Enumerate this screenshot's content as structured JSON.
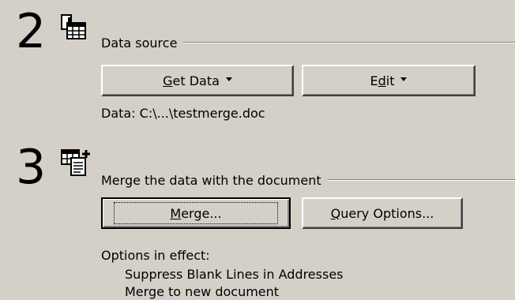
{
  "step2": {
    "number": "2",
    "icon": "data-source-table-icon",
    "title": "Data source",
    "get_data_button": {
      "pre": "",
      "mnemonic": "G",
      "post": "et Data",
      "icon": "dropdown-arrow-icon"
    },
    "edit_button": {
      "pre": "E",
      "mnemonic": "d",
      "post": "it",
      "icon": "dropdown-arrow-icon"
    },
    "data_label": "Data: C:\\...\\testmerge.doc"
  },
  "step3": {
    "number": "3",
    "icon": "merge-table-document-icon",
    "title": "Merge the data with the document",
    "merge_button": {
      "pre": "",
      "mnemonic": "M",
      "post": "erge..."
    },
    "query_button": {
      "pre": "",
      "mnemonic": "Q",
      "post": "uery Options..."
    },
    "options_header": "Options in effect:",
    "options": [
      "Suppress Blank Lines in Addresses",
      "Merge to new document"
    ]
  }
}
